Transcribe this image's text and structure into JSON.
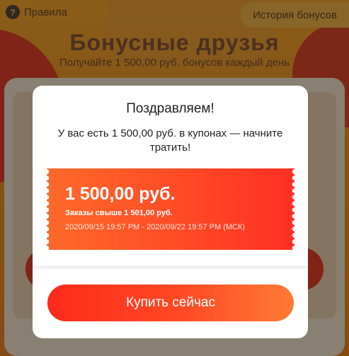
{
  "header": {
    "rules_label": "Правила",
    "rules_icon": "?",
    "history_label": "История бонусов"
  },
  "banner": {
    "title": "Бонусные друзья",
    "subtitle": "Получайте 1 500,00 руб. бонусов каждый день"
  },
  "modal": {
    "title": "Поздравляем!",
    "message": "У вас есть 1 500,00 руб. в купонах — начните тратить!",
    "coupon": {
      "amount": "1 500,00 руб.",
      "condition": "Заказы свыше 1 501,00 руб.",
      "validity": "2020/09/15 19:57 PM - 2020/09/22 19:57 PM (МСК)"
    },
    "buy_button_label": "Купить сейчас"
  },
  "colors": {
    "accent": "#ff4a26",
    "background": "#f59a2c"
  }
}
